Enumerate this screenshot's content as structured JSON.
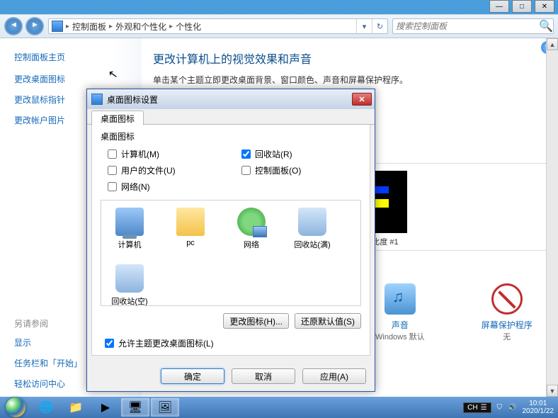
{
  "chrome": {
    "minimize": "—",
    "maximize": "□",
    "close": "✕"
  },
  "address": {
    "segs": [
      "控制面板",
      "外观和个性化",
      "个性化"
    ],
    "refresh": "↻"
  },
  "search": {
    "placeholder": "搜索控制面板"
  },
  "sidebar": {
    "home": "控制面板主页",
    "links": [
      "更改桌面图标",
      "更改鼠标指针",
      "更改帐户图片"
    ],
    "also_label": "另请参阅",
    "also": [
      "显示",
      "任务栏和「开始」",
      "轻松访问中心"
    ]
  },
  "main": {
    "title": "更改计算机上的视觉效果和声音",
    "desc": "单击某个主题立即更改桌面背景、窗口颜色、声音和屏幕保护程序。"
  },
  "theme": {
    "caption": "高对比度 #1"
  },
  "extras": {
    "sound": {
      "title": "声音",
      "sub": "Windows 默认"
    },
    "ss": {
      "title": "屏幕保护程序",
      "sub": "无"
    }
  },
  "dialog": {
    "title": "桌面图标设置",
    "tab": "桌面图标",
    "group": "桌面图标",
    "checks": {
      "computer": "计算机(M)",
      "recycle": "回收站(R)",
      "userfiles": "用户的文件(U)",
      "cpl": "控制面板(O)",
      "network": "网络(N)"
    },
    "icons": {
      "computer": "计算机",
      "pc": "pc",
      "network": "网络",
      "bin_full": "回收站(满)",
      "bin_empty": "回收站(空)"
    },
    "change_icon": "更改图标(H)...",
    "restore": "还原默认值(S)",
    "allow": "允许主题更改桌面图标(L)",
    "ok": "确定",
    "cancel": "取消",
    "apply": "应用(A)"
  },
  "taskbar": {
    "lang": "CH",
    "time": "10:01",
    "date": "2020/1/22"
  }
}
